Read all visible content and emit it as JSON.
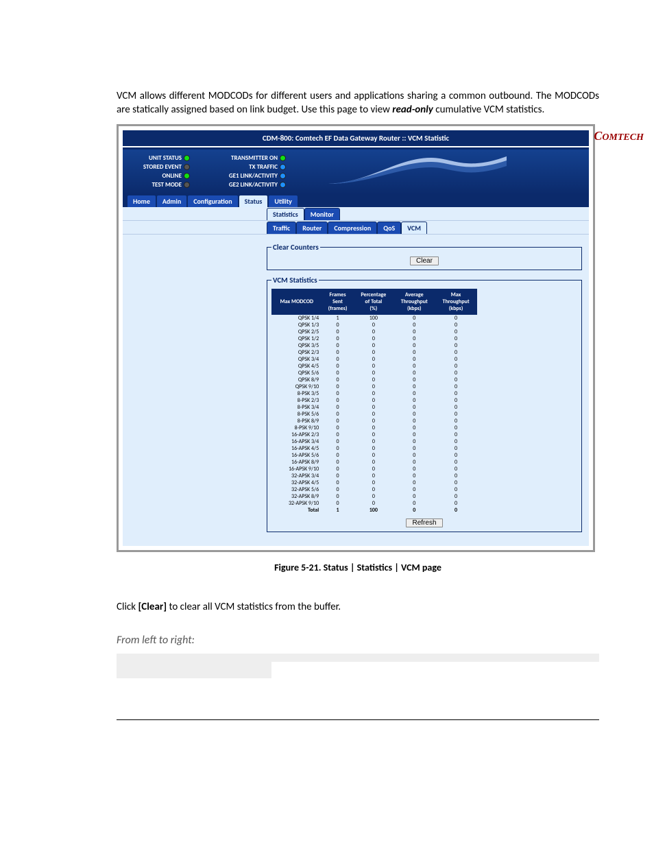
{
  "intro": {
    "p1": "VCM allows different MODCODs for different users and applications sharing a common outbound. The MODCODs are statically assigned based on link budget. Use this page to view ",
    "ro": "read-only",
    "p2": " cumulative VCM statistics."
  },
  "titlebar": "CDM-800: Comtech EF Data Gateway Router :: VCM Statistic",
  "logo_text": "COMTECH",
  "status_leds": [
    {
      "label": "UNIT STATUS",
      "color": "green"
    },
    {
      "label": "STORED EVENT",
      "color": "gray"
    },
    {
      "label": "ONLINE",
      "color": "green"
    },
    {
      "label": "TEST MODE",
      "color": "gray"
    }
  ],
  "activity_leds": [
    {
      "label": "TRANSMITTER ON",
      "color": "green"
    },
    {
      "label": "TX TRAFFIC",
      "color": "blue"
    },
    {
      "label": "GE1 LINK/ACTIVITY",
      "color": "blue"
    },
    {
      "label": "GE2 LINK/ACTIVITY",
      "color": "blue"
    }
  ],
  "tabs_main": [
    "Home",
    "Admin",
    "Configuration",
    "Status",
    "Utility"
  ],
  "tabs_main_active": "Status",
  "tabs_sub": [
    "Statistics",
    "Monitor"
  ],
  "tabs_sub_active": "Statistics",
  "tabs_sub2": [
    "Traffic",
    "Router",
    "Compression",
    "QoS",
    "VCM"
  ],
  "tabs_sub2_active": "VCM",
  "clear_legend": "Clear Counters",
  "clear_btn": "Clear",
  "vcm_legend": "VCM Statistics",
  "refresh_btn": "Refresh",
  "chart_data": {
    "type": "table",
    "columns": [
      "Max MODCOD",
      "Frames Sent (frames)",
      "Percentage of Total (%)",
      "Average Throughput (kbps)",
      "Max Throughput (kbps)"
    ],
    "rows": [
      [
        "QPSK 1/4",
        1,
        100,
        0,
        0
      ],
      [
        "QPSK 1/3",
        0,
        0,
        0,
        0
      ],
      [
        "QPSK 2/5",
        0,
        0,
        0,
        0
      ],
      [
        "QPSK 1/2",
        0,
        0,
        0,
        0
      ],
      [
        "QPSK 3/5",
        0,
        0,
        0,
        0
      ],
      [
        "QPSK 2/3",
        0,
        0,
        0,
        0
      ],
      [
        "QPSK 3/4",
        0,
        0,
        0,
        0
      ],
      [
        "QPSK 4/5",
        0,
        0,
        0,
        0
      ],
      [
        "QPSK 5/6",
        0,
        0,
        0,
        0
      ],
      [
        "QPSK 8/9",
        0,
        0,
        0,
        0
      ],
      [
        "QPSK 9/10",
        0,
        0,
        0,
        0
      ],
      [
        "8-PSK 3/5",
        0,
        0,
        0,
        0
      ],
      [
        "8-PSK 2/3",
        0,
        0,
        0,
        0
      ],
      [
        "8-PSK 3/4",
        0,
        0,
        0,
        0
      ],
      [
        "8-PSK 5/6",
        0,
        0,
        0,
        0
      ],
      [
        "8-PSK 8/9",
        0,
        0,
        0,
        0
      ],
      [
        "8-PSK 9/10",
        0,
        0,
        0,
        0
      ],
      [
        "16-APSK 2/3",
        0,
        0,
        0,
        0
      ],
      [
        "16-APSK 3/4",
        0,
        0,
        0,
        0
      ],
      [
        "16-APSK 4/5",
        0,
        0,
        0,
        0
      ],
      [
        "16-APSK 5/6",
        0,
        0,
        0,
        0
      ],
      [
        "16-APSK 8/9",
        0,
        0,
        0,
        0
      ],
      [
        "16-APSK 9/10",
        0,
        0,
        0,
        0
      ],
      [
        "32-APSK 3/4",
        0,
        0,
        0,
        0
      ],
      [
        "32-APSK 4/5",
        0,
        0,
        0,
        0
      ],
      [
        "32-APSK 5/6",
        0,
        0,
        0,
        0
      ],
      [
        "32-APSK 8/9",
        0,
        0,
        0,
        0
      ],
      [
        "32-APSK 9/10",
        0,
        0,
        0,
        0
      ]
    ],
    "total": [
      "Total",
      1,
      100,
      0,
      0
    ]
  },
  "caption": "Figure 5-21. Status | Statistics | VCM page",
  "sec_clear": "Clear Counters",
  "sec_clear_text_a": "Click ",
  "sec_clear_text_b": "[Clear]",
  "sec_clear_text_c": " to clear all VCM statistics from the buffer.",
  "sec_vcm": "VCM Statistics",
  "sec_vcm_sub": "From left to right:"
}
